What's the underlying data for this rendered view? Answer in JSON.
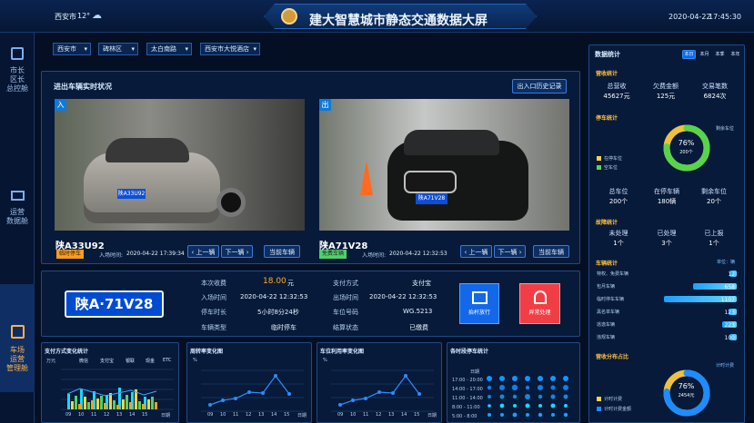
{
  "header": {
    "city": "西安市",
    "temperature": "12°",
    "weather_icon": "cloud-icon",
    "title": "建大智慧城市静态交通数据大屏",
    "date": "2020-04-22",
    "time": "17:45:30"
  },
  "left_nav": [
    {
      "label_lines": [
        "市长",
        "区长",
        "总控舱"
      ],
      "icon": "grid-icon"
    },
    {
      "label_lines": [
        "运营",
        "数据舱"
      ],
      "icon": "monitor-chart-icon"
    },
    {
      "label_lines": [
        "车场",
        "运营",
        "管理舱"
      ],
      "icon": "parking-icon",
      "active": true
    }
  ],
  "filters": {
    "city": "西安市",
    "district": "碑林区",
    "road": "太白南路",
    "lot": "西安市大悦酒店"
  },
  "vehicle_status": {
    "title": "进出车辆实时状况",
    "history_button": "出入口历史记录",
    "entry": {
      "badge": "入",
      "plate": "陕A33U92",
      "plate_image_text": "陕A33U92",
      "type_tag": "临时停车",
      "time_label": "入场时间:",
      "time": "2020-04-22 17:39:34",
      "prev": "上一辆",
      "next": "下一辆",
      "current": "当前车辆"
    },
    "exit": {
      "badge": "出",
      "plate": "陕A71V28",
      "plate_image_text": "陕A71V28",
      "type_tag": "免费车辆",
      "time_label": "入场时间:",
      "time": "2020-04-22 12:32:53",
      "prev": "上一辆",
      "next": "下一辆",
      "current": "当前车辆"
    }
  },
  "detail": {
    "plate_display": "陕A·71V28",
    "left_rows": [
      {
        "label": "本次收费",
        "value": "18.00",
        "unit": "元"
      },
      {
        "label": "入场时间",
        "value": "2020-04-22 12:32:53",
        "unit": ""
      },
      {
        "label": "停车时长",
        "value": "5小时8分24秒",
        "unit": ""
      },
      {
        "label": "车辆类型",
        "value": "临时停车",
        "unit": ""
      }
    ],
    "right_rows": [
      {
        "label": "支付方式",
        "value": "支付宝"
      },
      {
        "label": "出场时间",
        "value": "2020-04-22 12:32:53"
      },
      {
        "label": "车位号码",
        "value": "WG.5213"
      },
      {
        "label": "结算状态",
        "value": "已缴费"
      }
    ],
    "buttons": {
      "release": "抬杆放行",
      "exception": "异常处理"
    }
  },
  "charts": {
    "payment": {
      "title": "支付方式变化统计",
      "unit": "万元",
      "legend": [
        "微信",
        "支付宝",
        "银联",
        "现金",
        "ETC"
      ],
      "x": [
        "09",
        "10",
        "11",
        "12",
        "13",
        "14",
        "15",
        "日期"
      ],
      "yticks": [
        "10",
        "8",
        "6",
        "4",
        "2",
        "0"
      ]
    },
    "turnover": {
      "title": "周转率变化图",
      "unit": "%",
      "x": [
        "09",
        "10",
        "11",
        "12",
        "13",
        "14",
        "15",
        "日期"
      ],
      "yticks": [
        "60",
        "40",
        "20",
        "0"
      ]
    },
    "utilization": {
      "title": "车位利用率变化图",
      "unit": "%",
      "x": [
        "09",
        "10",
        "11",
        "12",
        "13",
        "14",
        "15",
        "日期"
      ],
      "yticks": [
        "60",
        "40",
        "20",
        "0"
      ]
    },
    "timeslot": {
      "title": "各时段停车统计",
      "xlabel": "日期",
      "rows": [
        "17:00 - 20:00",
        "14:00 - 17:00",
        "11:00 - 14:00",
        "8:00 - 11:00",
        "5:00 - 8:00"
      ],
      "x": [
        "09",
        "10",
        "11",
        "12",
        "13",
        "14",
        "15"
      ]
    }
  },
  "right_panel": {
    "title": "数据统计",
    "tabs": [
      "本日",
      "本月",
      "本季",
      "本年"
    ],
    "revenue": {
      "title": "营收统计",
      "items": [
        {
          "label": "总营收",
          "value": "45627元"
        },
        {
          "label": "欠费金额",
          "value": "125元"
        },
        {
          "label": "交易笔数",
          "value": "6824次"
        }
      ]
    },
    "parking": {
      "title": "停车统计",
      "remaining_label": "剩余车位",
      "donut_percent": "76%",
      "donut_count": "200个",
      "legend": [
        "在停车位",
        "空车位"
      ],
      "percent": 76,
      "items": [
        {
          "label": "总车位",
          "value": "200个"
        },
        {
          "label": "在停车辆",
          "value": "180辆"
        },
        {
          "label": "剩余车位",
          "value": "20个"
        }
      ]
    },
    "faults": {
      "title": "故障统计",
      "items": [
        {
          "label": "未处理",
          "value": "1个"
        },
        {
          "label": "已处理",
          "value": "3个"
        },
        {
          "label": "已上报",
          "value": "1个"
        }
      ]
    },
    "vehicles": {
      "title": "车辆统计",
      "unit": "单位：辆",
      "items": [
        {
          "label": "特权、免费车辆",
          "value": 12
        },
        {
          "label": "包月车辆",
          "value": 658
        },
        {
          "label": "临时停车车辆",
          "value": 1107
        },
        {
          "label": "黑名单车辆",
          "value": 123
        },
        {
          "label": "逃逸车辆",
          "value": 223
        },
        {
          "label": "违规车辆",
          "value": 100
        }
      ]
    },
    "income": {
      "title": "营收分布占比",
      "percent_label": "76%",
      "amount": "2454元",
      "legend_top": "计时计费",
      "legend": [
        "计时计费",
        "计时计费金额"
      ],
      "percent": 76
    }
  },
  "colors": {
    "accent_blue": "#1aa0ff",
    "orange": "#ff9d1c",
    "green": "#49d26f",
    "red": "#ff4a4a",
    "yellow": "#ffd33b"
  }
}
